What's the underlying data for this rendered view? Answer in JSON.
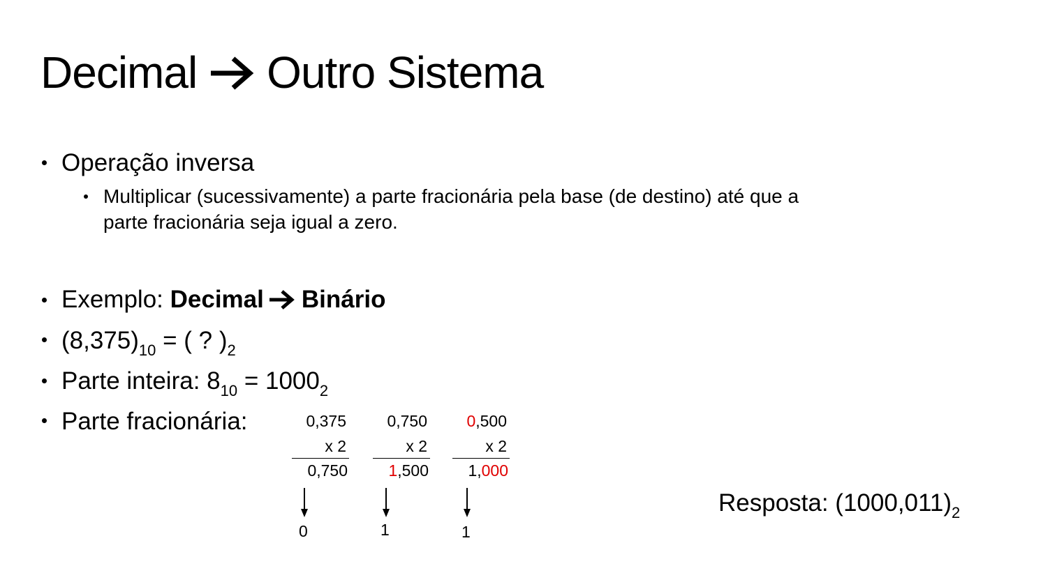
{
  "title": {
    "left": "Decimal",
    "right": "Outro Sistema"
  },
  "bullets": {
    "op": "Operação inversa",
    "op_sub_line1": "Multiplicar (sucessivamente) a parte fracionária pela base (de destino) até que a",
    "op_sub_line2": "parte fracionária seja igual a zero.",
    "example_prefix": "Exemplo: ",
    "example_from": "Decimal",
    "example_to": "Binário",
    "eq_open": "(8,375)",
    "eq_sub1": "10",
    "eq_mid": " = ( ? )",
    "eq_sub2": "2",
    "int_prefix": "Parte inteira: 8",
    "int_sub1": "10",
    "int_mid": " = 1000",
    "int_sub2": "2",
    "frac_label": "Parte fracionária:"
  },
  "steps": [
    {
      "multiplicand": "0,375",
      "multiplicand_head": "",
      "multiplier": "x 2",
      "result_head": "",
      "result_tail": "0,750",
      "bit": "0"
    },
    {
      "multiplicand": "0,750",
      "multiplicand_head": "",
      "multiplier": "x 2",
      "result_head": "1",
      "result_tail": ",500",
      "bit": "1"
    },
    {
      "multiplicand": ",500",
      "multiplicand_head": "0",
      "multiplier": "x 2",
      "result_head": "1,",
      "result_tail": "000",
      "bit": "1"
    }
  ],
  "answer": {
    "label": "Resposta: (1000,011)",
    "sub": "2"
  },
  "colors": {
    "highlight": "#e00000",
    "text": "#000000"
  }
}
